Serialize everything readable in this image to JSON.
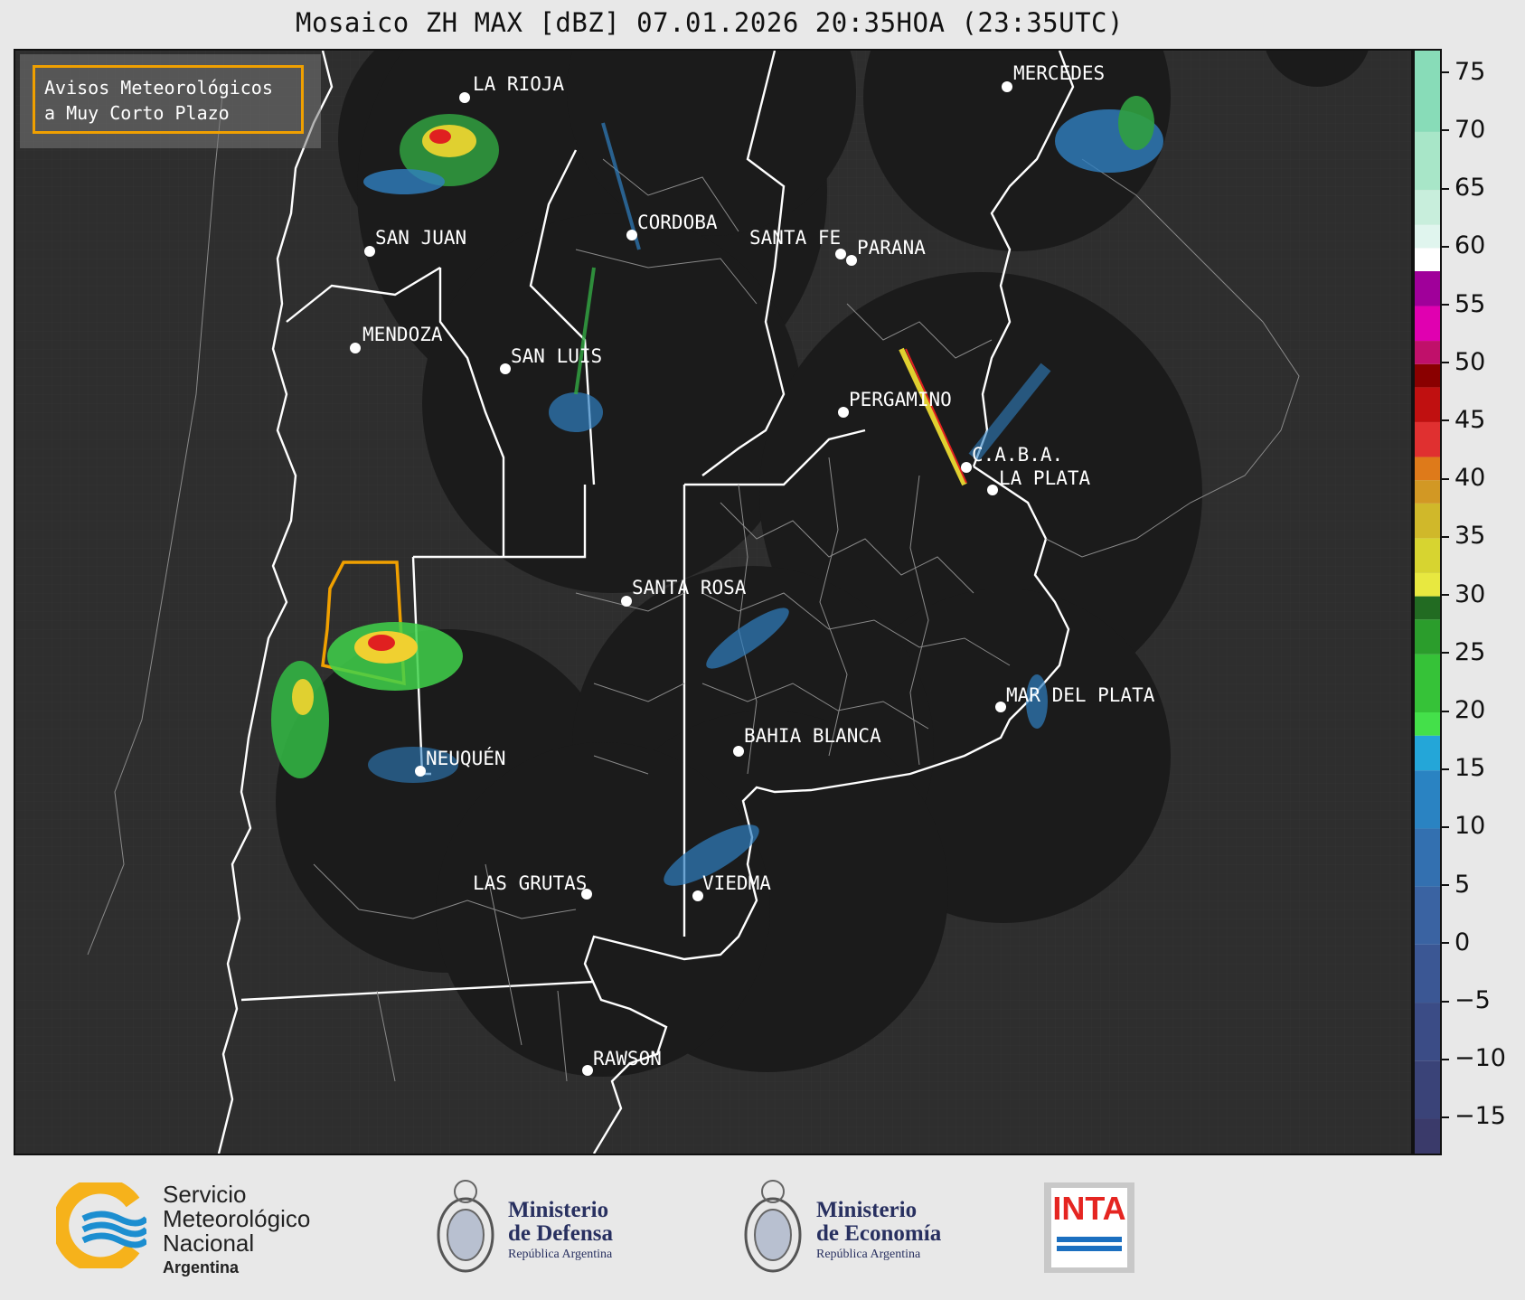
{
  "title": "Mosaico ZH MAX [dBZ] 07.01.2026 20:35HOA (23:35UTC)",
  "legend": {
    "line1": "Avisos Meteorológicos",
    "line2": "a Muy Corto Plazo",
    "border_color": "#f0a000"
  },
  "cities": [
    {
      "name": "LA RIOJA"
    },
    {
      "name": "SAN JUAN"
    },
    {
      "name": "CORDOBA"
    },
    {
      "name": "SANTA FE"
    },
    {
      "name": "PARANA"
    },
    {
      "name": "MERCEDES"
    },
    {
      "name": "MENDOZA"
    },
    {
      "name": "SAN LUIS"
    },
    {
      "name": "PERGAMINO"
    },
    {
      "name": "C.A.B.A."
    },
    {
      "name": "LA PLATA"
    },
    {
      "name": "SANTA ROSA"
    },
    {
      "name": "MAR DEL PLATA"
    },
    {
      "name": "BAHIA BLANCA"
    },
    {
      "name": "NEUQUÉN"
    },
    {
      "name": "LAS GRUTAS"
    },
    {
      "name": "VIEDMA"
    },
    {
      "name": "RAWSON"
    }
  ],
  "colorbar": {
    "unit": "dBZ",
    "min": -18,
    "max": 77,
    "tick_labels": [
      "75",
      "70",
      "65",
      "60",
      "55",
      "50",
      "45",
      "40",
      "35",
      "30",
      "25",
      "20",
      "15",
      "10",
      "5",
      "0",
      "−5",
      "−10",
      "−15"
    ]
  },
  "footer": {
    "smn_line1": "Servicio",
    "smn_line2": "Meteorológico",
    "smn_line3": "Nacional",
    "smn_line4": "Argentina",
    "defensa_line1": "Ministerio",
    "defensa_line2": "de Defensa",
    "defensa_line3": "República Argentina",
    "economia_line1": "Ministerio",
    "economia_line2": "de Economía",
    "economia_line3": "República Argentina",
    "inta": "INTA"
  }
}
